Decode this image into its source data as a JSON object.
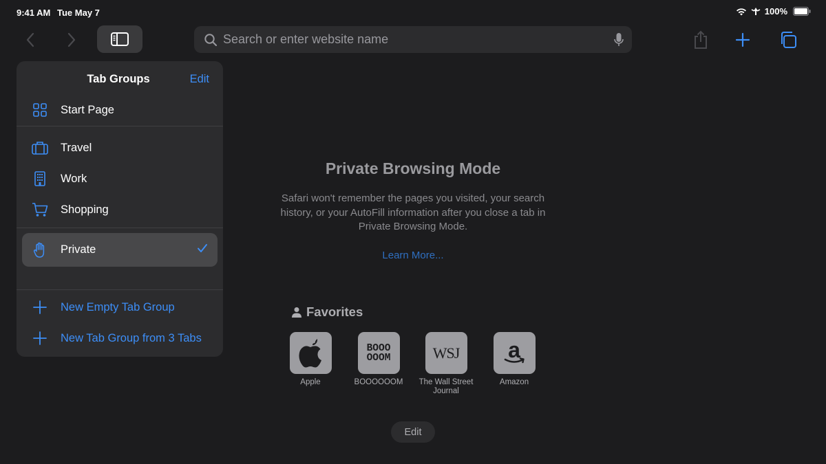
{
  "status": {
    "time": "9:41 AM",
    "date": "Tue May 7",
    "battery": "100%"
  },
  "toolbar": {
    "search_placeholder": "Search or enter website name"
  },
  "tab_groups": {
    "title": "Tab Groups",
    "edit": "Edit",
    "start_page": "Start Page",
    "groups": [
      "Travel",
      "Work",
      "Shopping"
    ],
    "private": "Private",
    "new_empty": "New Empty Tab Group",
    "new_from_tabs": "New Tab Group from 3 Tabs"
  },
  "main": {
    "title": "Private Browsing Mode",
    "description": "Safari won't remember the pages you visited, your search history, or your AutoFill information after you close a tab in Private Browsing Mode.",
    "learn_more": "Learn More...",
    "favorites_title": "Favorites",
    "favorites": [
      {
        "label": "Apple",
        "tile": ""
      },
      {
        "label": "BOOOOOOM",
        "tile": "BOOO OOOM"
      },
      {
        "label": "The Wall Street Journal",
        "tile": "WSJ"
      },
      {
        "label": "Amazon",
        "tile": ""
      }
    ],
    "edit": "Edit"
  },
  "colors": {
    "accent": "#3d8ef7",
    "background": "#1c1c1e",
    "panel": "#2c2c2e"
  }
}
